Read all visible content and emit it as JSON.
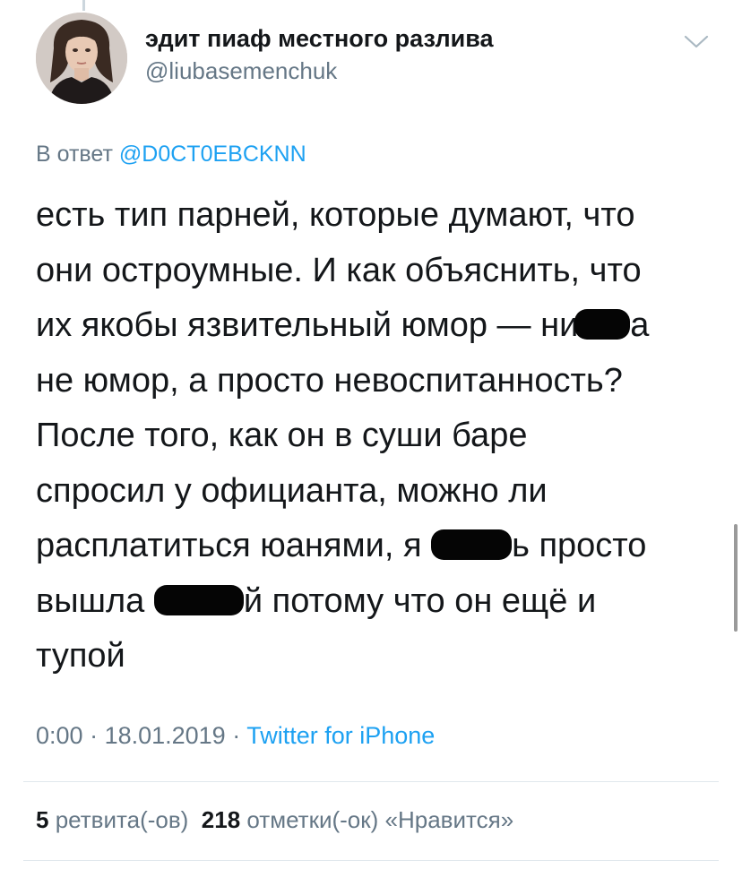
{
  "tweet": {
    "author": {
      "display_name": "эдит пиаф местного разлива",
      "handle": "@liubasemenchuk"
    },
    "reply": {
      "prefix": "В ответ",
      "mention": "@D0CT0EBCKNN"
    },
    "lines": [
      {
        "before": "есть тип парней, которые думают, что",
        "after": ""
      },
      {
        "before": "они остроумные. И как объяснить, что",
        "after": ""
      },
      {
        "before": "их якобы язвительный юмор — ни",
        "after": "а"
      },
      {
        "before": "не юмор, а просто невоспитанность?",
        "after": ""
      },
      {
        "before": "После того, как он в суши баре",
        "after": ""
      },
      {
        "before": "спросил у официанта, можно ли",
        "after": ""
      },
      {
        "before": "расплатиться юанями, я ",
        "after": "ь просто"
      },
      {
        "before": "вышла ",
        "after": "й потому что он ещё и"
      },
      {
        "before": "тупой",
        "after": ""
      }
    ],
    "meta": {
      "time": "0:00",
      "sep1": " · ",
      "date": "18.01.2019",
      "sep2": " · ",
      "source": "Twitter for iPhone"
    },
    "stats": {
      "retweets_count": "5",
      "retweets_label": "ретвита(-ов)",
      "likes_count": "218",
      "likes_label": "отметки(-ок) «Нравится»"
    }
  },
  "colors": {
    "text": "#14171a",
    "secondary": "#657786",
    "link": "#1da1f2",
    "divider": "#e1e8ed",
    "redaction": "#050505"
  },
  "icons": {
    "menu": "chevron-down-icon",
    "avatar": "profile-photo"
  }
}
